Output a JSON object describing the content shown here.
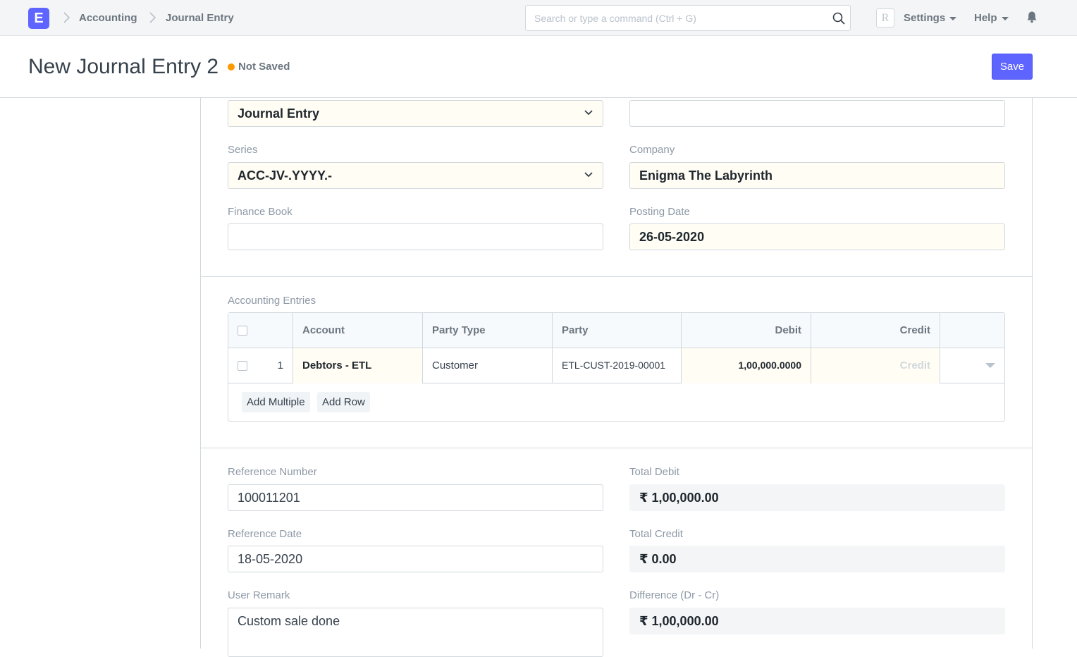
{
  "navbar": {
    "logo_letter": "E",
    "breadcrumbs": [
      "Accounting",
      "Journal Entry"
    ],
    "search_placeholder": "Search or type a command (Ctrl + G)",
    "avatar_letter": "R",
    "settings_label": "Settings",
    "help_label": "Help"
  },
  "page": {
    "title": "New Journal Entry 2",
    "status": "Not Saved",
    "save_label": "Save"
  },
  "form": {
    "entry_type": "Journal Entry",
    "top_right_value": "",
    "series_label": "Series",
    "series_value": "ACC-JV-.YYYY.-",
    "company_label": "Company",
    "company_value": "Enigma The Labyrinth",
    "finance_book_label": "Finance Book",
    "finance_book_value": "",
    "posting_date_label": "Posting Date",
    "posting_date_value": "26-05-2020"
  },
  "entries": {
    "section_label": "Accounting Entries",
    "columns": [
      "Account",
      "Party Type",
      "Party",
      "Debit",
      "Credit"
    ],
    "rows": [
      {
        "idx": "1",
        "account": "Debtors - ETL",
        "party_type": "Customer",
        "party": "ETL-CUST-2019-00001",
        "debit": "1,00,000.0000",
        "credit": "Credit"
      }
    ],
    "add_multiple_label": "Add Multiple",
    "add_row_label": "Add Row"
  },
  "reference": {
    "ref_number_label": "Reference Number",
    "ref_number_value": "100011201",
    "ref_date_label": "Reference Date",
    "ref_date_value": "18-05-2020",
    "user_remark_label": "User Remark",
    "user_remark_value": "Custom sale done",
    "total_debit_label": "Total Debit",
    "total_debit_value": "₹ 1,00,000.00",
    "total_credit_label": "Total Credit",
    "total_credit_value": "₹ 0.00",
    "difference_label": "Difference (Dr - Cr)",
    "difference_value": "₹ 1,00,000.00"
  }
}
